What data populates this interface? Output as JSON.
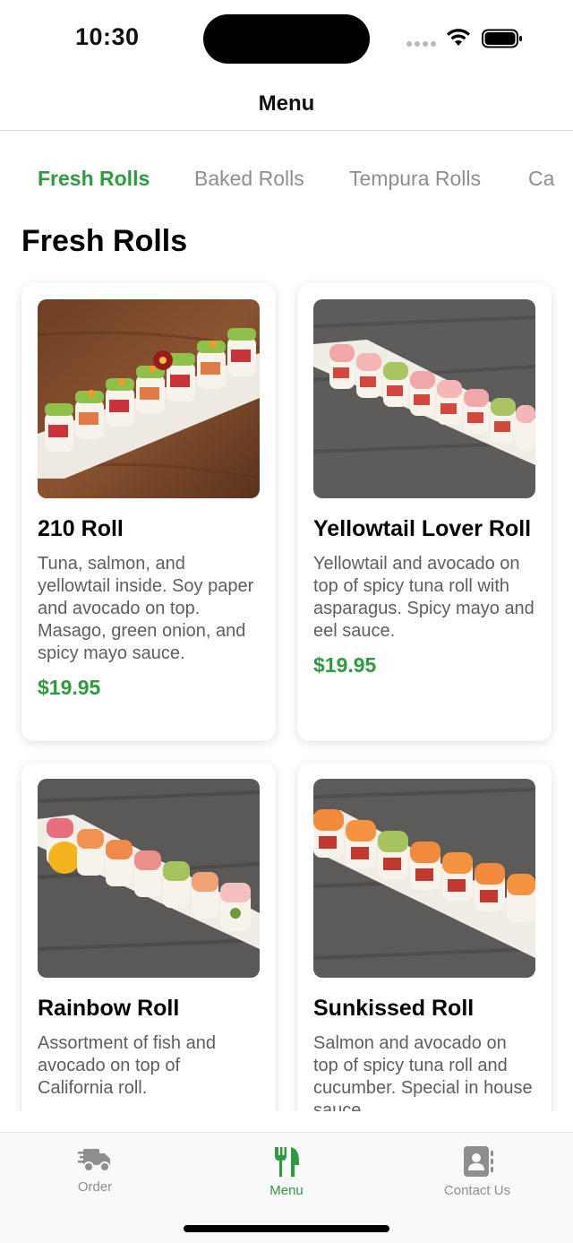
{
  "status_bar": {
    "time": "10:30"
  },
  "nav": {
    "title": "Menu"
  },
  "categories": [
    {
      "label": "Fresh Rolls",
      "active": true
    },
    {
      "label": "Baked Rolls",
      "active": false
    },
    {
      "label": "Tempura Rolls",
      "active": false
    },
    {
      "label": "Ca",
      "active": false
    }
  ],
  "section": {
    "title": "Fresh Rolls"
  },
  "items": [
    {
      "name": "210 Roll",
      "description": "Tuna, salmon, and yellowtail inside. Soy paper and avocado on top. Masago, green onion, and spicy mayo sauce.",
      "price": "$19.95",
      "image": "sushi-roll-photo-wood"
    },
    {
      "name": "Yellowtail Lover Roll",
      "description": "Yellowtail and avocado on top of spicy tuna roll with asparagus. Spicy mayo and eel sauce.",
      "price": "$19.95",
      "image": "sushi-roll-photo-pink"
    },
    {
      "name": "Rainbow Roll",
      "description": "Assortment of fish and avocado on top of California roll.",
      "price": "",
      "image": "sushi-roll-photo-rainbow"
    },
    {
      "name": "Sunkissed Roll",
      "description": "Salmon and avocado on top of spicy tuna roll and cucumber. Special in house sauce.",
      "price": "",
      "image": "sushi-roll-photo-salmon"
    }
  ],
  "tab_bar": {
    "items": [
      {
        "label": "Order",
        "icon": "delivery-truck-icon",
        "active": false
      },
      {
        "label": "Menu",
        "icon": "fork-knife-icon",
        "active": true
      },
      {
        "label": "Contact Us",
        "icon": "contact-book-icon",
        "active": false
      }
    ]
  },
  "colors": {
    "accent": "#2e9b3e",
    "inactive": "#8e8e8e",
    "description": "#5e5e5e"
  }
}
